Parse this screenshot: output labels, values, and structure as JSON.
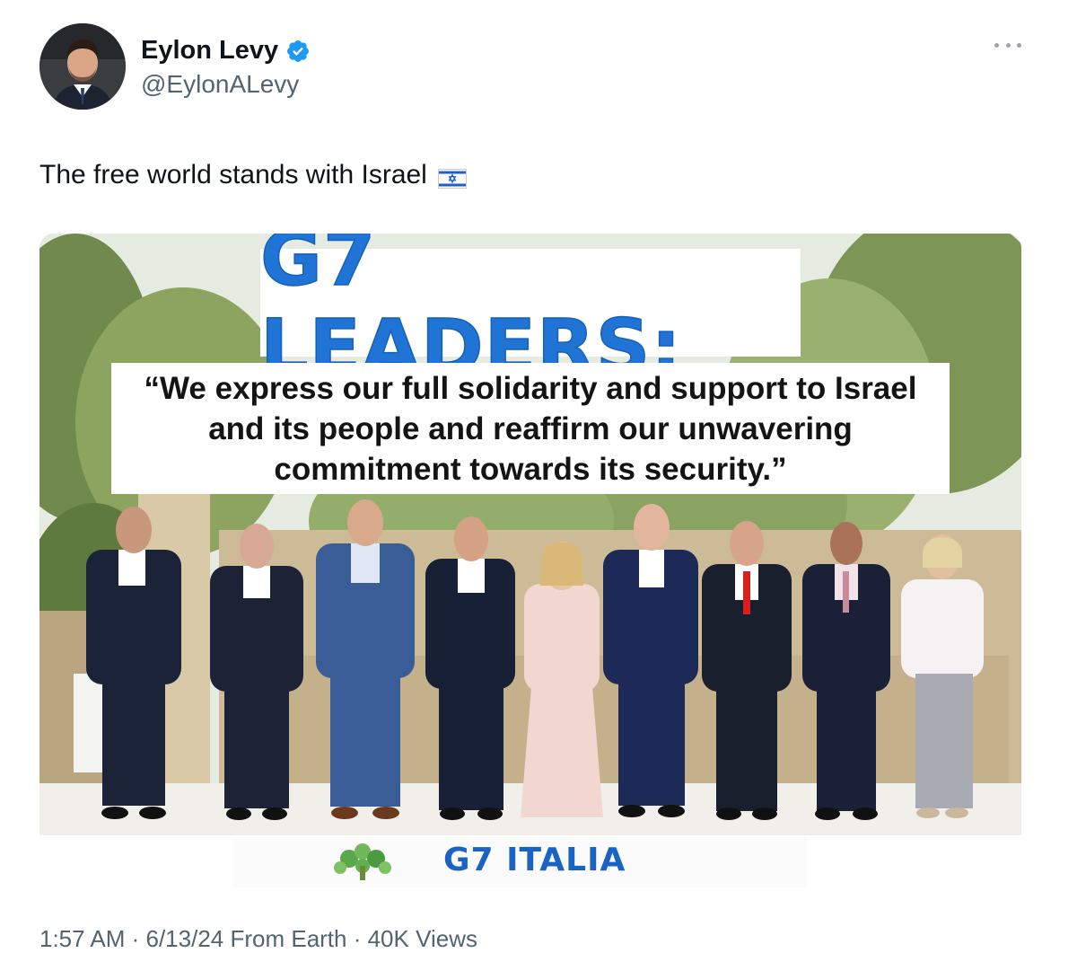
{
  "author": {
    "display_name": "Eylon Levy",
    "handle": "@EylonALevy",
    "verified": true
  },
  "tweet": {
    "text": "The free world stands with Israel",
    "flag_emoji": "israel-flag"
  },
  "media": {
    "headline": "G7 LEADERS:",
    "quote": "“We express our full solidarity and support to Israel and its people and reaffirm our unwavering commitment towards its security.”",
    "banner_text": "G7 ITALIA"
  },
  "footer": {
    "partial_text": "1:57 AM · 6/13/24 From Earth · 40K Views"
  },
  "colors": {
    "accent": "#1d9bf0",
    "headline_blue": "#1f74d6",
    "muted": "#536471"
  }
}
